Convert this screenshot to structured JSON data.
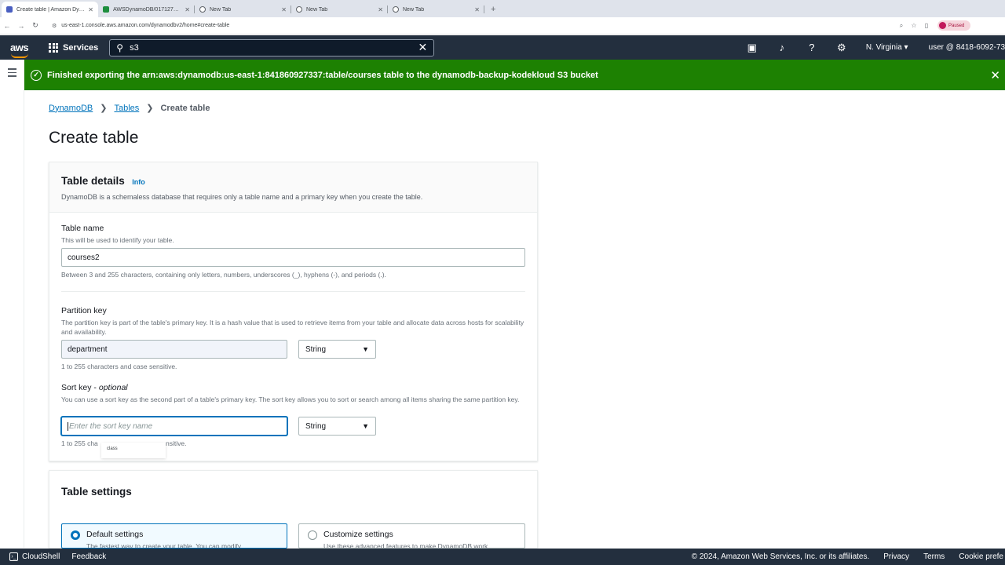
{
  "browser": {
    "tabs": [
      {
        "label": "Create table | Amazon Dynamo",
        "active": true,
        "favicon_color": "#4a5fc1"
      },
      {
        "label": "AWSDynamoDB/017127150511/",
        "active": false,
        "favicon_color": "#1e8e3e"
      },
      {
        "label": "New Tab",
        "active": false,
        "favicon_color": "#5f6368"
      },
      {
        "label": "New Tab",
        "active": false,
        "favicon_color": "#5f6368"
      },
      {
        "label": "New Tab",
        "active": false,
        "favicon_color": "#5f6368"
      }
    ],
    "new_tab_glyph": "+",
    "url": "us-east-1.console.aws.amazon.com/dynamodbv2/home#create-table",
    "profile_status": "Paused"
  },
  "aws_nav": {
    "logo": "aws",
    "services_label": "Services",
    "search_value": "s3",
    "region": "N. Virginia ▾",
    "user": "user @ 8418-6092-73"
  },
  "flash": {
    "message": "Finished exporting the arn:aws:dynamodb:us-east-1:841860927337:table/courses table to the dynamodb-backup-kodekloud S3 bucket",
    "color": "#1d8102"
  },
  "breadcrumb": {
    "items": [
      "DynamoDB",
      "Tables"
    ],
    "current": "Create table"
  },
  "page": {
    "title": "Create table"
  },
  "table_details": {
    "title": "Table details",
    "info": "Info",
    "description": "DynamoDB is a schemaless database that requires only a table name and a primary key when you create the table.",
    "table_name": {
      "label": "Table name",
      "description": "This will be used to identify your table.",
      "value": "courses2",
      "constraint": "Between 3 and 255 characters, containing only letters, numbers, underscores (_), hyphens (-), and periods (.)."
    },
    "partition_key": {
      "label": "Partition key",
      "description": "The partition key is part of the table's primary key. It is a hash value that is used to retrieve items from your table and allocate data across hosts for scalability and availability.",
      "value": "department",
      "type": "String",
      "constraint": "1 to 255 characters and case sensitive."
    },
    "sort_key": {
      "label": "Sort key - ",
      "optional": "optional",
      "description": "You can use a sort key as the second part of a table's primary key. The sort key allows you to sort or search among all items sharing the same partition key.",
      "placeholder": "Enter the sort key name",
      "type": "String",
      "constraint_visible": "1 to 255 cha",
      "constraint_tail": "nsitive.",
      "autocomplete_suggestion": "class"
    }
  },
  "table_settings": {
    "title": "Table settings",
    "options": [
      {
        "label": "Default settings",
        "subtext": "The fastest way to create your table. You can modify",
        "selected": true
      },
      {
        "label": "Customize settings",
        "subtext": "Use these advanced features to make DynamoDB work",
        "selected": false
      }
    ]
  },
  "footer": {
    "cloudshell": "CloudShell",
    "feedback": "Feedback",
    "copyright": "© 2024, Amazon Web Services, Inc. or its affiliates.",
    "privacy": "Privacy",
    "terms": "Terms",
    "cookies": "Cookie prefe"
  },
  "colors": {
    "accent": "#0073bb",
    "nav_bg": "#232f3e",
    "success": "#1d8102"
  }
}
